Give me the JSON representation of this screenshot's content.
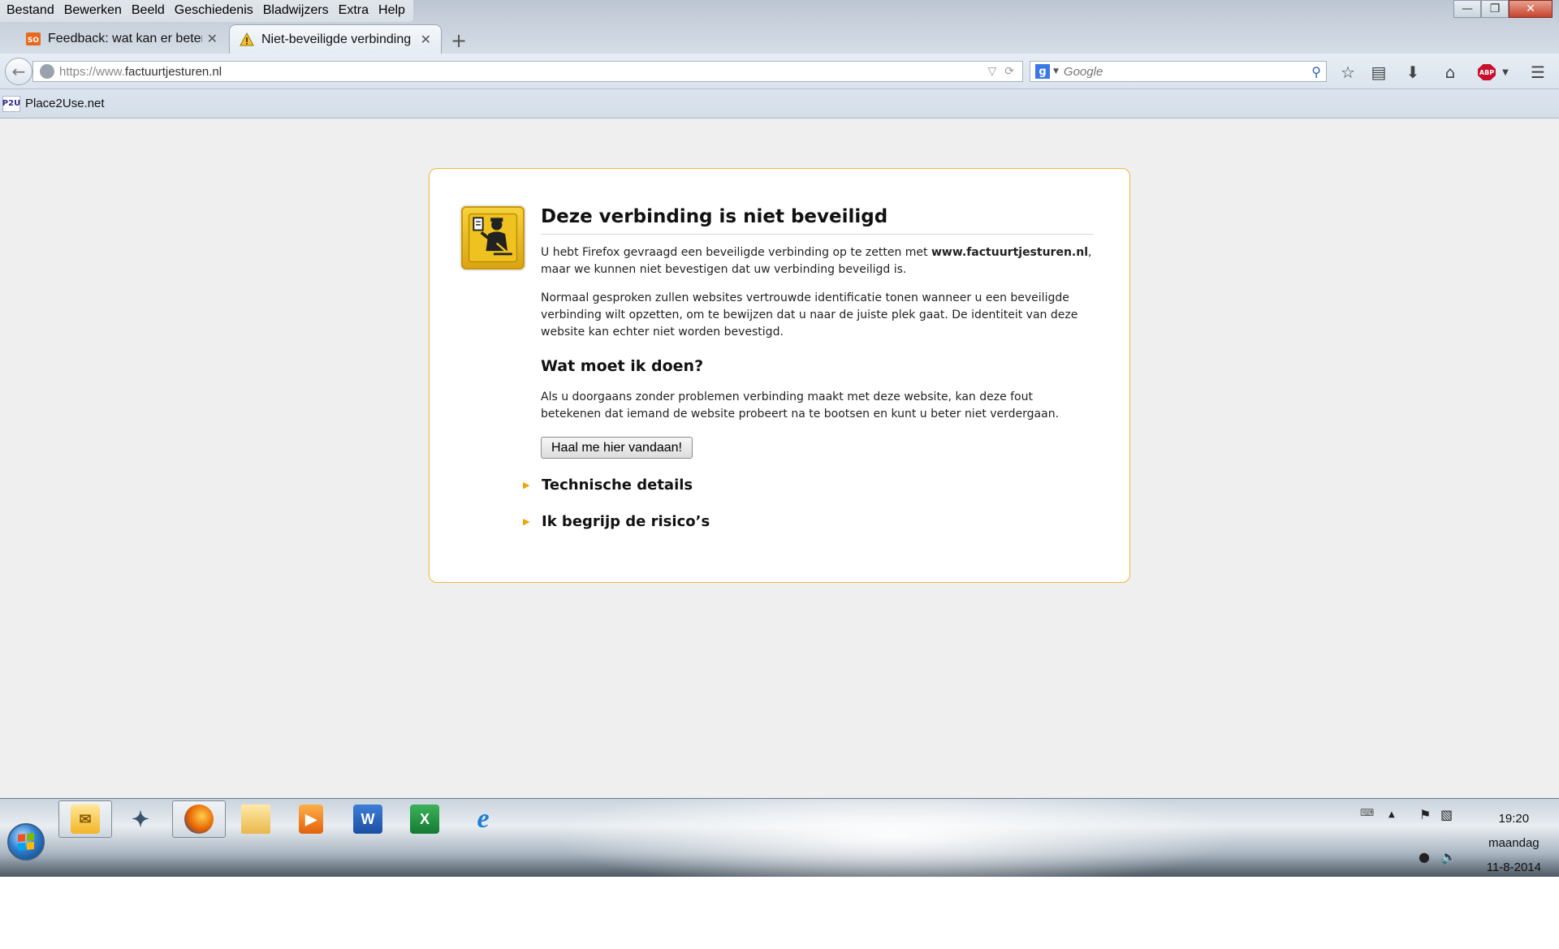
{
  "menu": [
    "Bestand",
    "Bewerken",
    "Beeld",
    "Geschiedenis",
    "Bladwijzers",
    "Extra",
    "Help"
  ],
  "tabs": [
    {
      "title": "Feedback: wat kan er beter...",
      "active": false
    },
    {
      "title": "Niet-beveiligde verbinding",
      "active": true
    }
  ],
  "urlbar": {
    "prefix": "https://www.",
    "domain": "factuurtjesturen.nl"
  },
  "search": {
    "engine": "Google",
    "placeholder": "Google"
  },
  "bookmarks": [
    {
      "label": "Place2Use.net",
      "icon_text": "P2U"
    }
  ],
  "error": {
    "title": "Deze verbinding is niet beveiligd",
    "intro_before": "U hebt Firefox gevraagd een beveiligde verbinding op te zetten met ",
    "intro_site": "www.factuurtjesturen.nl",
    "intro_after": ", maar we kunnen niet bevestigen dat uw verbinding beveiligd is.",
    "paragraph2": "Normaal gesproken zullen websites vertrouwde identificatie tonen wanneer u een beveiligde verbinding wilt opzetten, om te bewijzen dat u naar de juiste plek gaat. De identiteit van deze website kan echter niet worden bevestigd.",
    "what_heading": "Wat moet ik doen?",
    "paragraph3": "Als u doorgaans zonder problemen verbinding maakt met deze website, kan deze fout betekenen dat iemand de website probeert na te bootsen en kunt u beter niet verdergaan.",
    "escape_button": "Haal me hier vandaan!",
    "expanders": [
      "Technische details",
      "Ik begrijp de risico’s"
    ]
  },
  "taskbar": {
    "apps": [
      "outlook-icon",
      "satellite-icon",
      "firefox-icon",
      "explorer-icon",
      "media-player-icon",
      "word-icon",
      "excel-icon",
      "internet-explorer-icon"
    ],
    "clock": {
      "time": "19:20",
      "day": "maandag",
      "date": "11-8-2014"
    }
  },
  "colors": {
    "accent_border": "#f2b53d",
    "expander_triangle": "#f0a500",
    "icon_yellow": "#f6d23a"
  }
}
